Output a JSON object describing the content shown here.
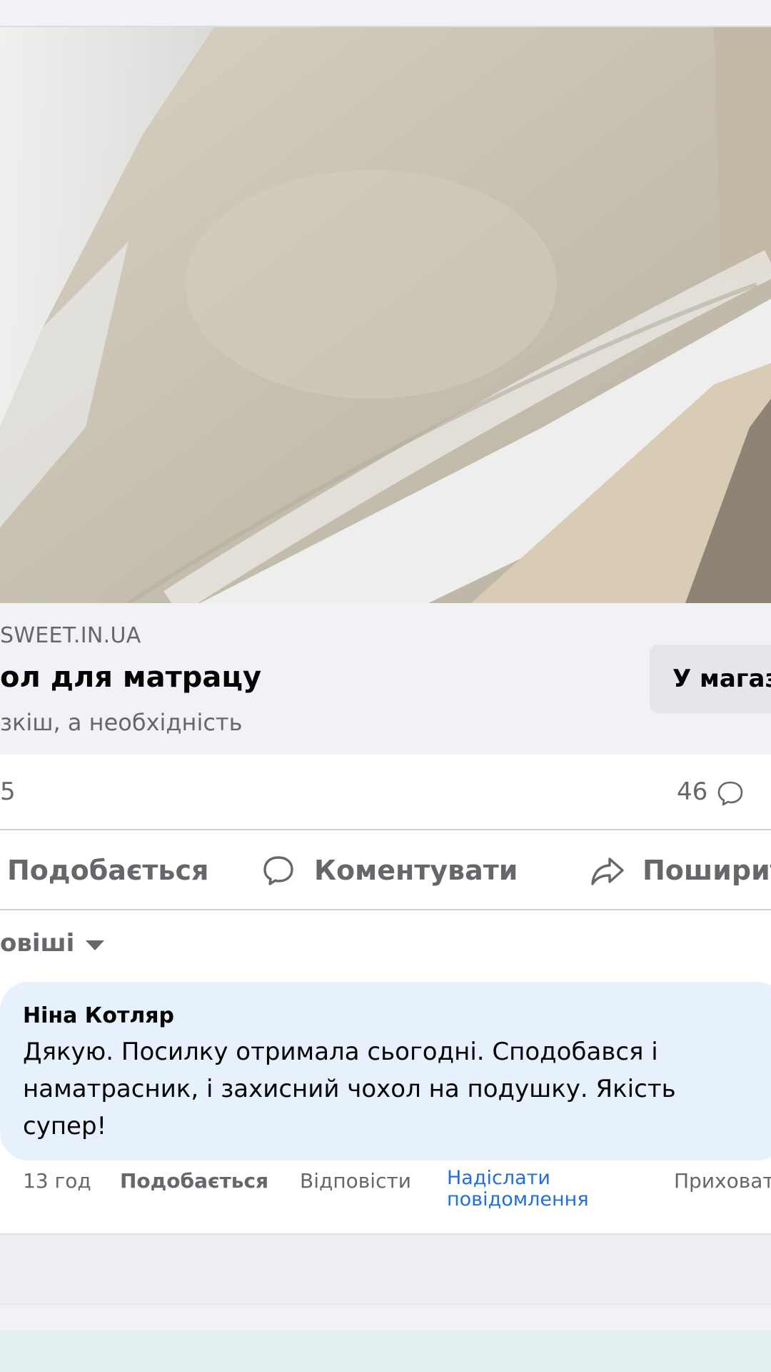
{
  "post": {
    "link_domain": "SWEET.IN.UA",
    "link_title": "ол для матрацу",
    "link_description": "зкіш, а необхідність",
    "shop_button_label": "У магаз"
  },
  "stats": {
    "reactions_count": "5",
    "comments_count": "46"
  },
  "actions": {
    "like_label": "Подобається",
    "comment_label": "Коментувати",
    "share_label": "Поширит"
  },
  "comments": {
    "sort_label": "овіші",
    "items": [
      {
        "author": "Ніна Котляр",
        "text": "Дякую. Посилку отримала сьогодні. Сподобався і наматрасник, і захисний чохол на подушку. Якість супер!",
        "time": "13 год",
        "like_label": "Подобається",
        "reply_label": "Відповісти",
        "message_label": "Надіслати повідомлення",
        "hide_label": "Приховат"
      }
    ]
  },
  "colors": {
    "link_blue": "#216fdb",
    "secondary_text": "#65676b",
    "bubble_bg": "#e7f1fc"
  },
  "icons": [
    "comment-icon",
    "share-icon",
    "chevron-down-icon"
  ]
}
